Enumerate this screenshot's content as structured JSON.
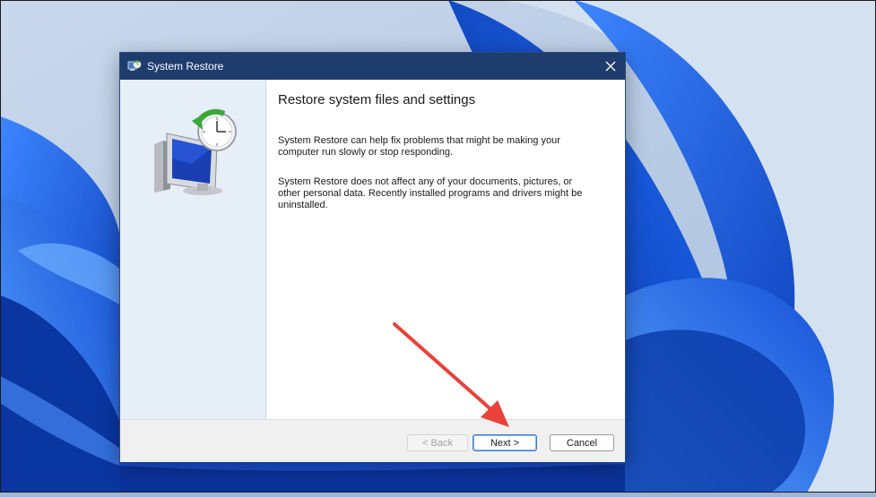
{
  "window": {
    "title": "System Restore",
    "close_icon": "close-icon"
  },
  "content": {
    "heading": "Restore system files and settings",
    "paragraph1": "System Restore can help fix problems that might be making your computer run slowly or stop responding.",
    "paragraph2": "System Restore does not affect any of your documents, pictures, or other personal data. Recently installed programs and drivers might be uninstalled."
  },
  "buttons": {
    "back_label": "< Back",
    "next_label": "Next >",
    "cancel_label": "Cancel"
  },
  "colors": {
    "titlebar": "#1e3d6e",
    "annotation_arrow": "#e8423a",
    "accent": "#3a7bd5"
  }
}
